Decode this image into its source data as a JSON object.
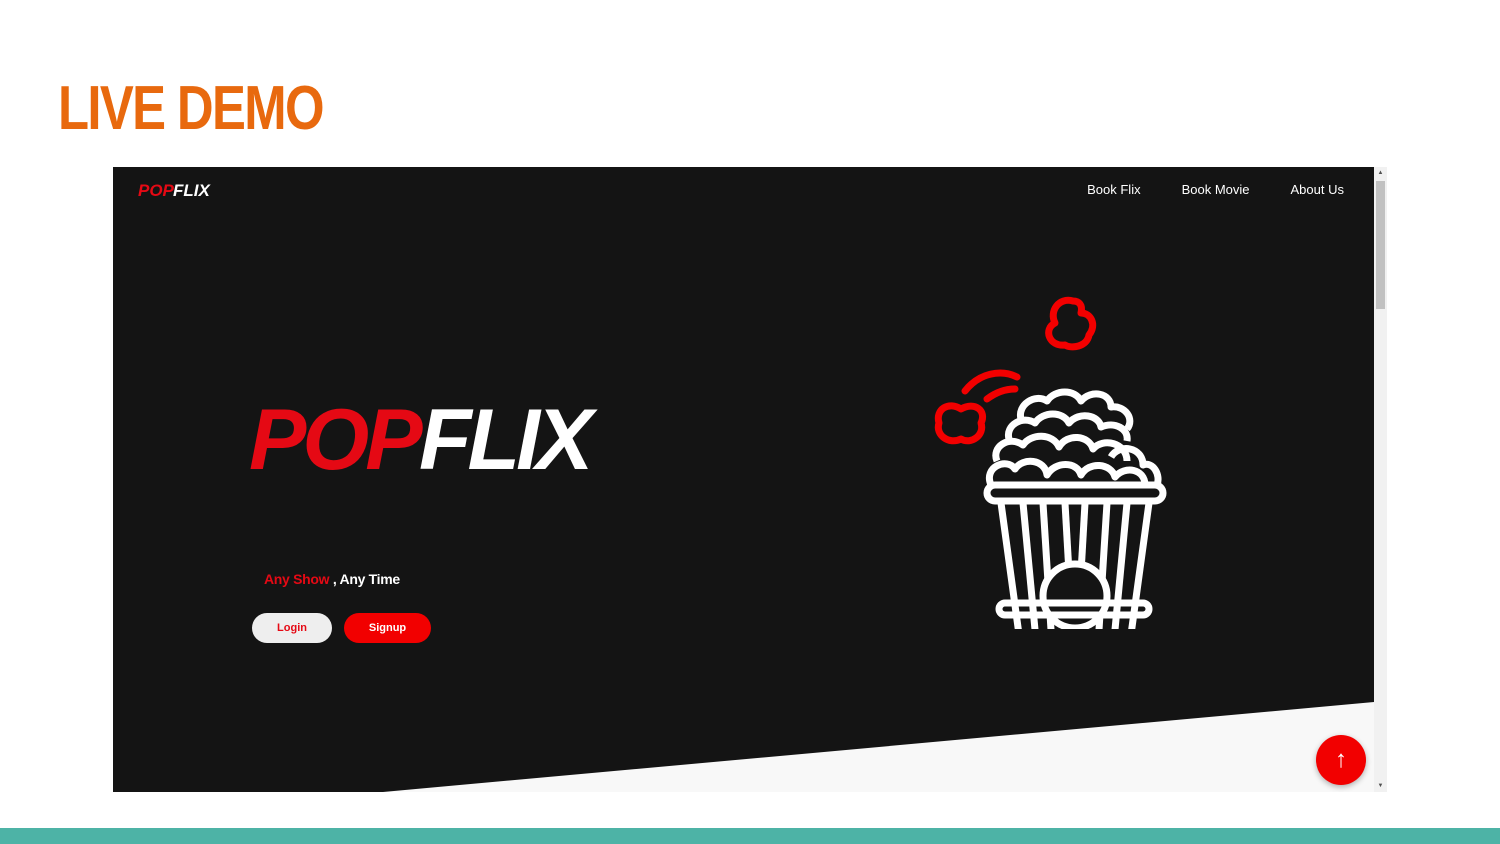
{
  "slide": {
    "title": "LIVE DEMO"
  },
  "site": {
    "logo_part1": "POP",
    "logo_part2": "FLIX",
    "nav": [
      "Book Flix",
      "Book Movie",
      "About Us"
    ],
    "tagline_part1": "Any Show",
    "tagline_part2": " , Any Time",
    "login_label": "Login",
    "signup_label": "Signup",
    "scroll_top_glyph": "↑"
  },
  "colors": {
    "slide_title": "#e8690e",
    "brand_red": "#e50914",
    "site_background": "#141414",
    "bottom_bar": "#4db3a6"
  },
  "icons": [
    "popcorn-bucket-icon",
    "arrow-up-icon"
  ]
}
